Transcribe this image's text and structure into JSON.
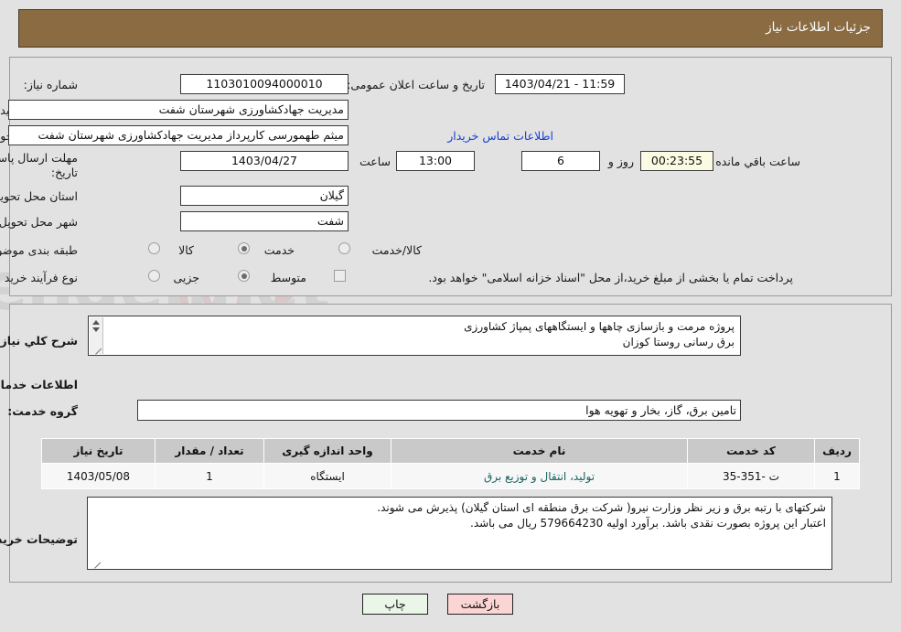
{
  "header": {
    "title": "جزئیات اطلاعات نیاز"
  },
  "form": {
    "need_number_label": "شماره نیاز:",
    "need_number_value": "1103010094000010",
    "public_announce_label": "تاریخ و ساعت اعلان عمومی:",
    "public_announce_value": "1403/04/21 - 11:59",
    "buyer_org_label": "نام دستگاه خریدار:",
    "buyer_org_value": "مدیریت جهادکشاورزی شهرستان شفت",
    "creator_label": "ایجاد کننده درخواست:",
    "creator_value": "میثم طهمورسی کارپرداز مدیریت جهادکشاورزی شهرستان شفت",
    "contact_link": "اطلاعات تماس خریدار",
    "deadline_label_line1": "مهلت ارسال پاسخ: تا",
    "deadline_label_line2": "تاریخ:",
    "deadline_date": "1403/04/27",
    "hour_label": "ساعت",
    "hour_value": "13:00",
    "days_value": "6",
    "days_label": "روز و",
    "countdown_value": "00:23:55",
    "countdown_label": "ساعت باقي مانده",
    "province_label": "استان محل تحویل:",
    "province_value": "گیلان",
    "city_label": "شهر محل تحویل:",
    "city_value": "شفت",
    "category_label": "طبقه بندی موضوعی:",
    "category_options": [
      "کالا",
      "خدمت",
      "کالا/خدمت"
    ],
    "category_selected": "خدمت",
    "process_label": "نوع فرآیند خرید :",
    "process_options": [
      "جزیی",
      "متوسط"
    ],
    "process_selected": "متوسط",
    "treasury_note": "پرداخت تمام یا بخشی از مبلغ خرید،از محل \"اسناد خزانه اسلامی\" خواهد بود.",
    "treasury_checked": false
  },
  "description": {
    "label": "شرح کلي نیاز:",
    "value": "پروژه مرمت و بازسازی چاهها و ایستگاههای پمپاژ کشاورزی\nبرق رسانی روستا کوزان"
  },
  "services": {
    "section_title": "اطلاعات خدمات مورد نیاز",
    "group_label": "گروه خدمت:",
    "group_value": "تامین برق، گاز، بخار و تهویه هوا",
    "table": {
      "columns": [
        "ردیف",
        "کد خدمت",
        "نام خدمت",
        "واحد اندازه گیری",
        "تعداد / مقدار",
        "تاریخ نیاز"
      ],
      "rows": [
        {
          "row": "1",
          "code": "ت -351-35",
          "name": "تولید، انتقال و توزیع برق",
          "unit": "ایستگاه",
          "qty": "1",
          "date": "1403/05/08"
        }
      ]
    }
  },
  "buyer_notes": {
    "label": "توضیحات خریدار:",
    "value": "شرکتهای با رتبه برق و زیر نظر وزارت نیرو( شرکت برق منطقه ای استان گیلان) پذیرش می شوند.\nاعتبار این پروژه بصورت نقدی باشد. برآورد اولیه 579664230 ریال می باشد."
  },
  "buttons": {
    "print": "چاپ",
    "back": "بازگشت"
  },
  "colors": {
    "header_bg": "#8a6b42",
    "page_bg": "#e2e2e2",
    "link": "#1a3fd0",
    "service_name": "#16635f",
    "print_btn": "#eaf6e8",
    "back_btn": "#fbd4d4",
    "countdown_bg": "#fbfbe3"
  },
  "watermark": {
    "text": "AriaTender.net"
  }
}
